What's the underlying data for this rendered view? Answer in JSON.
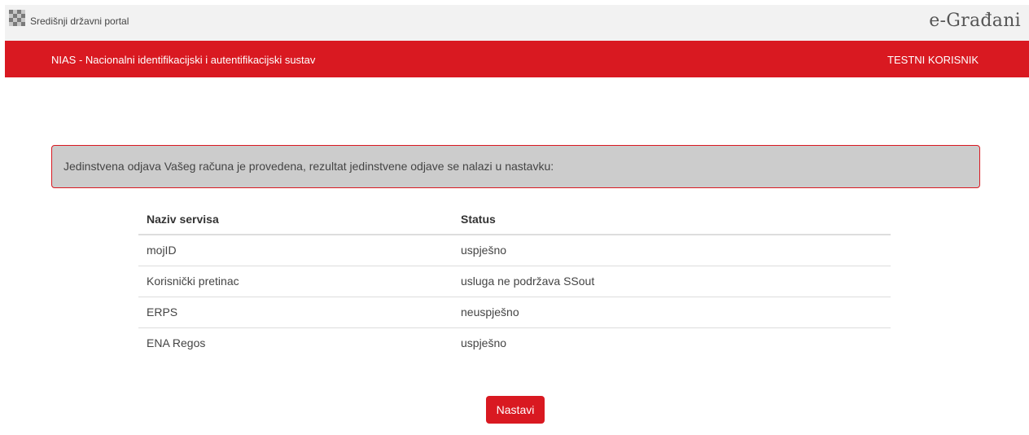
{
  "header": {
    "portal_label": "Središnji državni portal",
    "brand": "e-Građani"
  },
  "nav": {
    "title": "NIAS - Nacionalni identifikacijski i autentifikacijski sustav",
    "user": "TESTNI KORISNIK"
  },
  "alert": {
    "text": "Jedinstvena odjava Vašeg računa je provedena, rezultat jedinstvene odjave se nalazi u nastavku:"
  },
  "table": {
    "columns": [
      "Naziv servisa",
      "Status"
    ],
    "rows": [
      {
        "service": "mojID",
        "status": "uspješno"
      },
      {
        "service": "Korisnički pretinac",
        "status": "usluga ne podržava SSout"
      },
      {
        "service": "ERPS",
        "status": "neuspješno"
      },
      {
        "service": "ENA Regos",
        "status": "uspješno"
      }
    ]
  },
  "actions": {
    "continue_label": "Nastavi"
  },
  "colors": {
    "accent": "#d91921",
    "alert_bg": "#cccccc",
    "topbar_bg": "#f2f2f2"
  },
  "icons": {
    "logo": "checkerboard-logo-icon"
  }
}
